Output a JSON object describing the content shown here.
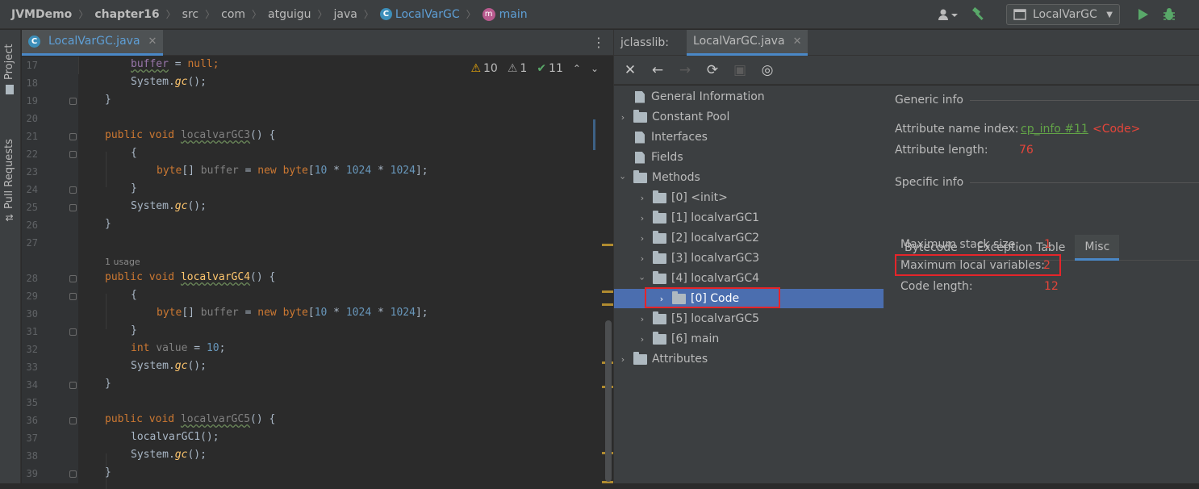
{
  "breadcrumbs": {
    "project": "JVMDemo",
    "module": "chapter16",
    "p1": "src",
    "p2": "com",
    "p3": "atguigu",
    "p4": "java",
    "cls": "LocalVarGC",
    "method": "main"
  },
  "toolbar": {
    "run_config": "LocalVarGC"
  },
  "left_bar": {
    "project": "Project",
    "pull_requests": "Pull Requests"
  },
  "editor": {
    "tab": "LocalVarGC.java",
    "inspections": {
      "warnings": "10",
      "weak_warnings": "1",
      "ok": "11"
    },
    "line_numbers": [
      "17",
      "18",
      "19",
      "20",
      "21",
      "22",
      "23",
      "24",
      "25",
      "26",
      "27",
      "28",
      "29",
      "30",
      "31",
      "32",
      "33",
      "34",
      "35",
      "36",
      "37",
      "38",
      "39"
    ],
    "usage_hint": "1 usage",
    "code": {
      "l17": {
        "a": "buffer",
        "b": " = ",
        "c": "null",
        ";": ";"
      },
      "gc": "System.",
      "gcfn": "gc",
      "gctail": "();",
      "brace_close": "}",
      "brace_open": "{",
      "public": "public",
      "void": "void",
      "gc3": "localvarGC3",
      "gc4": "localvarGC4",
      "gc5": "localvarGC5",
      "sig_tail": "() {",
      "byte": "byte",
      "arr": "[] ",
      "buffer": "buffer",
      "assign": " = ",
      "new": "new",
      "n10": "10",
      "n1024": "1024",
      "times": " * ",
      "int": "int",
      "value": "value",
      "call1": "localvarGC1();"
    }
  },
  "jclasslib": {
    "label": "jclasslib:",
    "tab": "LocalVarGC.java",
    "tree": {
      "general": "General Information",
      "constant_pool": "Constant Pool",
      "interfaces": "Interfaces",
      "fields": "Fields",
      "methods": "Methods",
      "m0": "[0] <init>",
      "m1": "[1] localvarGC1",
      "m2": "[2] localvarGC2",
      "m3": "[3] localvarGC3",
      "m4": "[4] localvarGC4",
      "m4_code": "[0] Code",
      "m5": "[5] localvarGC5",
      "m6": "[6] main",
      "attributes": "Attributes"
    },
    "generic_info": {
      "title": "Generic info",
      "name_index_label": "Attribute name index:",
      "name_index_link": "cp_info #11",
      "name_index_value": "<Code>",
      "length_label": "Attribute length:",
      "length_value": "76"
    },
    "specific_info": {
      "title": "Specific info",
      "tabs": [
        "Bytecode",
        "Exception Table",
        "Misc"
      ],
      "max_stack_label": "Maximum stack size:",
      "max_stack_value": "1",
      "max_locals_label": "Maximum local variables:",
      "max_locals_value": "2",
      "code_length_label": "Code length:",
      "code_length_value": "12"
    }
  },
  "colors": {
    "accent": "#4a88c7",
    "selection": "#4b6eaf",
    "highlight": "#e5252a",
    "value_red": "#e5453a",
    "link_green": "#62a447"
  }
}
